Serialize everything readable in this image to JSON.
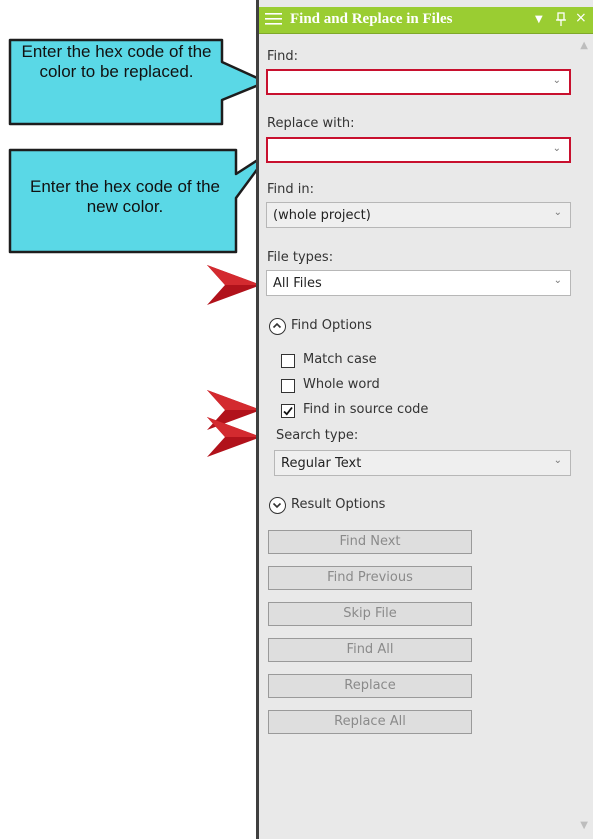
{
  "panel": {
    "title": "Find and Replace in Files",
    "pin_icon": "pin-icon",
    "close_glyph": "×",
    "dropdown_glyph": "▼"
  },
  "find": {
    "label": "Find:",
    "value": ""
  },
  "replace": {
    "label": "Replace with:",
    "value": ""
  },
  "find_in": {
    "label": "Find in:",
    "value": "(whole project)"
  },
  "file_types": {
    "label": "File types:",
    "value": "All Files"
  },
  "find_options": {
    "label": "Find Options",
    "checkboxes": [
      {
        "label": "Match case",
        "checked": false
      },
      {
        "label": "Whole word",
        "checked": false
      },
      {
        "label": "Find in source code",
        "checked": true
      }
    ],
    "search_type_label": "Search type:",
    "search_type_value": "Regular Text"
  },
  "result_options": {
    "label": "Result Options"
  },
  "buttons": {
    "find_next": "Find Next",
    "find_previous": "Find Previous",
    "skip_file": "Skip File",
    "find_all": "Find All",
    "replace": "Replace",
    "replace_all": "Replace All"
  },
  "callouts": {
    "find": "Enter the hex code of the color to be replaced.",
    "replace": "Enter the hex code of the new color."
  },
  "colors": {
    "title_bar": "#9acd32",
    "callout_fill": "#5ad8e6",
    "highlight_border": "#c8102e",
    "arrow": "#b1121b"
  }
}
